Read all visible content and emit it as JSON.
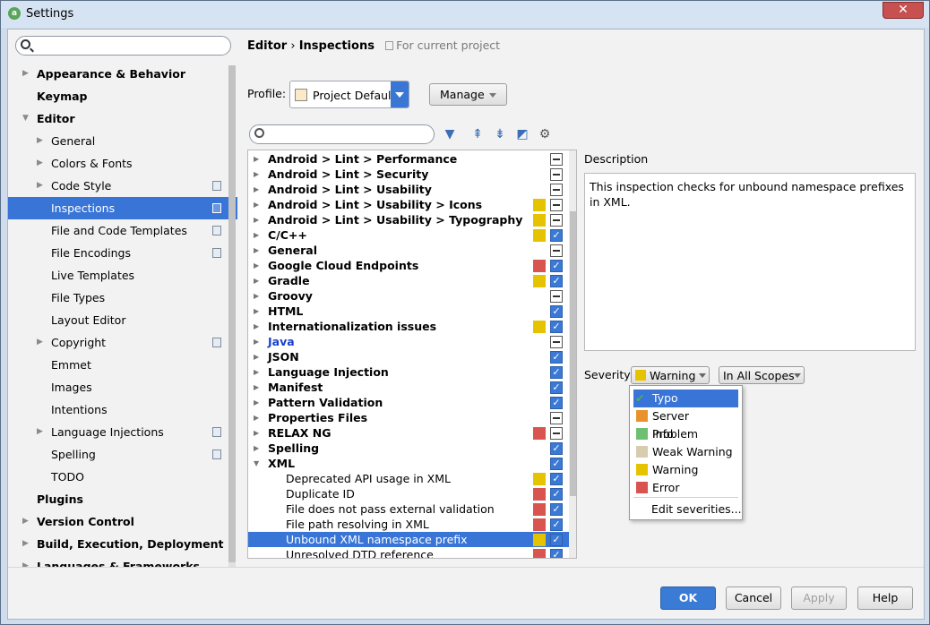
{
  "window": {
    "title": "Settings"
  },
  "sidebar": {
    "items": [
      {
        "label": "Appearance & Behavior",
        "bold": true,
        "arrow": "right",
        "level": 0,
        "sel": false,
        "copy": false
      },
      {
        "label": "Keymap",
        "bold": true,
        "arrow": "",
        "level": 0,
        "sel": false,
        "copy": false
      },
      {
        "label": "Editor",
        "bold": true,
        "arrow": "down",
        "level": 0,
        "sel": false,
        "copy": false
      },
      {
        "label": "General",
        "bold": false,
        "arrow": "right",
        "level": 1,
        "sel": false,
        "copy": false
      },
      {
        "label": "Colors & Fonts",
        "bold": false,
        "arrow": "right",
        "level": 1,
        "sel": false,
        "copy": false
      },
      {
        "label": "Code Style",
        "bold": false,
        "arrow": "right",
        "level": 1,
        "sel": false,
        "copy": true
      },
      {
        "label": "Inspections",
        "bold": false,
        "arrow": "",
        "level": 1,
        "sel": true,
        "copy": true
      },
      {
        "label": "File and Code Templates",
        "bold": false,
        "arrow": "",
        "level": 1,
        "sel": false,
        "copy": true
      },
      {
        "label": "File Encodings",
        "bold": false,
        "arrow": "",
        "level": 1,
        "sel": false,
        "copy": true
      },
      {
        "label": "Live Templates",
        "bold": false,
        "arrow": "",
        "level": 1,
        "sel": false,
        "copy": false
      },
      {
        "label": "File Types",
        "bold": false,
        "arrow": "",
        "level": 1,
        "sel": false,
        "copy": false
      },
      {
        "label": "Layout Editor",
        "bold": false,
        "arrow": "",
        "level": 1,
        "sel": false,
        "copy": false
      },
      {
        "label": "Copyright",
        "bold": false,
        "arrow": "right",
        "level": 1,
        "sel": false,
        "copy": true
      },
      {
        "label": "Emmet",
        "bold": false,
        "arrow": "",
        "level": 1,
        "sel": false,
        "copy": false
      },
      {
        "label": "Images",
        "bold": false,
        "arrow": "",
        "level": 1,
        "sel": false,
        "copy": false
      },
      {
        "label": "Intentions",
        "bold": false,
        "arrow": "",
        "level": 1,
        "sel": false,
        "copy": false
      },
      {
        "label": "Language Injections",
        "bold": false,
        "arrow": "right",
        "level": 1,
        "sel": false,
        "copy": true
      },
      {
        "label": "Spelling",
        "bold": false,
        "arrow": "",
        "level": 1,
        "sel": false,
        "copy": true
      },
      {
        "label": "TODO",
        "bold": false,
        "arrow": "",
        "level": 1,
        "sel": false,
        "copy": false
      },
      {
        "label": "Plugins",
        "bold": true,
        "arrow": "",
        "level": 0,
        "sel": false,
        "copy": false
      },
      {
        "label": "Version Control",
        "bold": true,
        "arrow": "right",
        "level": 0,
        "sel": false,
        "copy": false
      },
      {
        "label": "Build, Execution, Deployment",
        "bold": true,
        "arrow": "right",
        "level": 0,
        "sel": false,
        "copy": false
      },
      {
        "label": "Languages & Frameworks",
        "bold": true,
        "arrow": "right",
        "level": 0,
        "sel": false,
        "copy": false
      }
    ]
  },
  "breadcrumb": {
    "part1": "Editor",
    "sep": "›",
    "part2": "Inspections",
    "note": "For current project"
  },
  "profile": {
    "label": "Profile:",
    "value": "Project Default",
    "manage": "Manage"
  },
  "inspections": [
    {
      "label": "Android > Lint > Performance",
      "bold": true,
      "level": 0,
      "arrow": "right",
      "sev": "",
      "check": "partial",
      "blue": false,
      "sel": false
    },
    {
      "label": "Android > Lint > Security",
      "bold": true,
      "level": 0,
      "arrow": "right",
      "sev": "",
      "check": "partial",
      "blue": false,
      "sel": false
    },
    {
      "label": "Android > Lint > Usability",
      "bold": true,
      "level": 0,
      "arrow": "right",
      "sev": "",
      "check": "partial",
      "blue": false,
      "sel": false
    },
    {
      "label": "Android > Lint > Usability > Icons",
      "bold": true,
      "level": 0,
      "arrow": "right",
      "sev": "#e6c300",
      "check": "partial",
      "blue": false,
      "sel": false
    },
    {
      "label": "Android > Lint > Usability > Typography",
      "bold": true,
      "level": 0,
      "arrow": "right",
      "sev": "#e6c300",
      "check": "partial",
      "blue": false,
      "sel": false
    },
    {
      "label": "C/C++",
      "bold": true,
      "level": 0,
      "arrow": "right",
      "sev": "#e6c300",
      "check": "on",
      "blue": false,
      "sel": false
    },
    {
      "label": "General",
      "bold": true,
      "level": 0,
      "arrow": "right",
      "sev": "",
      "check": "partial",
      "blue": false,
      "sel": false
    },
    {
      "label": "Google Cloud Endpoints",
      "bold": true,
      "level": 0,
      "arrow": "right",
      "sev": "#d9534f",
      "check": "on",
      "blue": false,
      "sel": false
    },
    {
      "label": "Gradle",
      "bold": true,
      "level": 0,
      "arrow": "right",
      "sev": "#e6c300",
      "check": "on",
      "blue": false,
      "sel": false
    },
    {
      "label": "Groovy",
      "bold": true,
      "level": 0,
      "arrow": "right",
      "sev": "",
      "check": "partial",
      "blue": false,
      "sel": false
    },
    {
      "label": "HTML",
      "bold": true,
      "level": 0,
      "arrow": "right",
      "sev": "",
      "check": "on",
      "blue": false,
      "sel": false
    },
    {
      "label": "Internationalization issues",
      "bold": true,
      "level": 0,
      "arrow": "right",
      "sev": "#e6c300",
      "check": "on",
      "blue": false,
      "sel": false
    },
    {
      "label": "Java",
      "bold": true,
      "level": 0,
      "arrow": "right",
      "sev": "",
      "check": "partial",
      "blue": true,
      "sel": false
    },
    {
      "label": "JSON",
      "bold": true,
      "level": 0,
      "arrow": "right",
      "sev": "",
      "check": "on",
      "blue": false,
      "sel": false
    },
    {
      "label": "Language Injection",
      "bold": true,
      "level": 0,
      "arrow": "right",
      "sev": "",
      "check": "on",
      "blue": false,
      "sel": false
    },
    {
      "label": "Manifest",
      "bold": true,
      "level": 0,
      "arrow": "right",
      "sev": "",
      "check": "on",
      "blue": false,
      "sel": false
    },
    {
      "label": "Pattern Validation",
      "bold": true,
      "level": 0,
      "arrow": "right",
      "sev": "",
      "check": "on",
      "blue": false,
      "sel": false
    },
    {
      "label": "Properties Files",
      "bold": true,
      "level": 0,
      "arrow": "right",
      "sev": "",
      "check": "partial",
      "blue": false,
      "sel": false
    },
    {
      "label": "RELAX NG",
      "bold": true,
      "level": 0,
      "arrow": "right",
      "sev": "#d9534f",
      "check": "partial",
      "blue": false,
      "sel": false
    },
    {
      "label": "Spelling",
      "bold": true,
      "level": 0,
      "arrow": "right",
      "sev": "",
      "check": "on",
      "blue": false,
      "sel": false
    },
    {
      "label": "XML",
      "bold": true,
      "level": 0,
      "arrow": "down",
      "sev": "",
      "check": "on",
      "blue": false,
      "sel": false
    },
    {
      "label": "Deprecated API usage in XML",
      "bold": false,
      "level": 1,
      "arrow": "",
      "sev": "#e6c300",
      "check": "on",
      "blue": false,
      "sel": false
    },
    {
      "label": "Duplicate ID",
      "bold": false,
      "level": 1,
      "arrow": "",
      "sev": "#d9534f",
      "check": "on",
      "blue": false,
      "sel": false
    },
    {
      "label": "File does not pass external validation",
      "bold": false,
      "level": 1,
      "arrow": "",
      "sev": "#d9534f",
      "check": "on",
      "blue": false,
      "sel": false
    },
    {
      "label": "File path resolving in XML",
      "bold": false,
      "level": 1,
      "arrow": "",
      "sev": "#d9534f",
      "check": "on",
      "blue": false,
      "sel": false
    },
    {
      "label": "Unbound XML namespace prefix",
      "bold": false,
      "level": 1,
      "arrow": "",
      "sev": "#e6c300",
      "check": "on",
      "blue": false,
      "sel": true
    },
    {
      "label": "Unresolved DTD reference",
      "bold": false,
      "level": 1,
      "arrow": "",
      "sev": "#d9534f",
      "check": "on",
      "blue": false,
      "sel": false
    }
  ],
  "description": {
    "label": "Description",
    "text": "This inspection checks for unbound namespace prefixes in XML."
  },
  "severity": {
    "label": "Severity:",
    "value": "Warning",
    "scope": "In All Scopes"
  },
  "severity_menu": [
    {
      "label": "Typo",
      "color": "#4caf50",
      "sel": true
    },
    {
      "label": "Server Problem",
      "color": "#e8912d",
      "sel": false
    },
    {
      "label": "Info",
      "color": "#6fbf73",
      "sel": false
    },
    {
      "label": "Weak Warning",
      "color": "#d8ccae",
      "sel": false
    },
    {
      "label": "Warning",
      "color": "#e6c300",
      "sel": false
    },
    {
      "label": "Error",
      "color": "#d9534f",
      "sel": false
    }
  ],
  "severity_edit": "Edit severities...",
  "buttons": {
    "ok": "OK",
    "cancel": "Cancel",
    "apply": "Apply",
    "help": "Help"
  }
}
